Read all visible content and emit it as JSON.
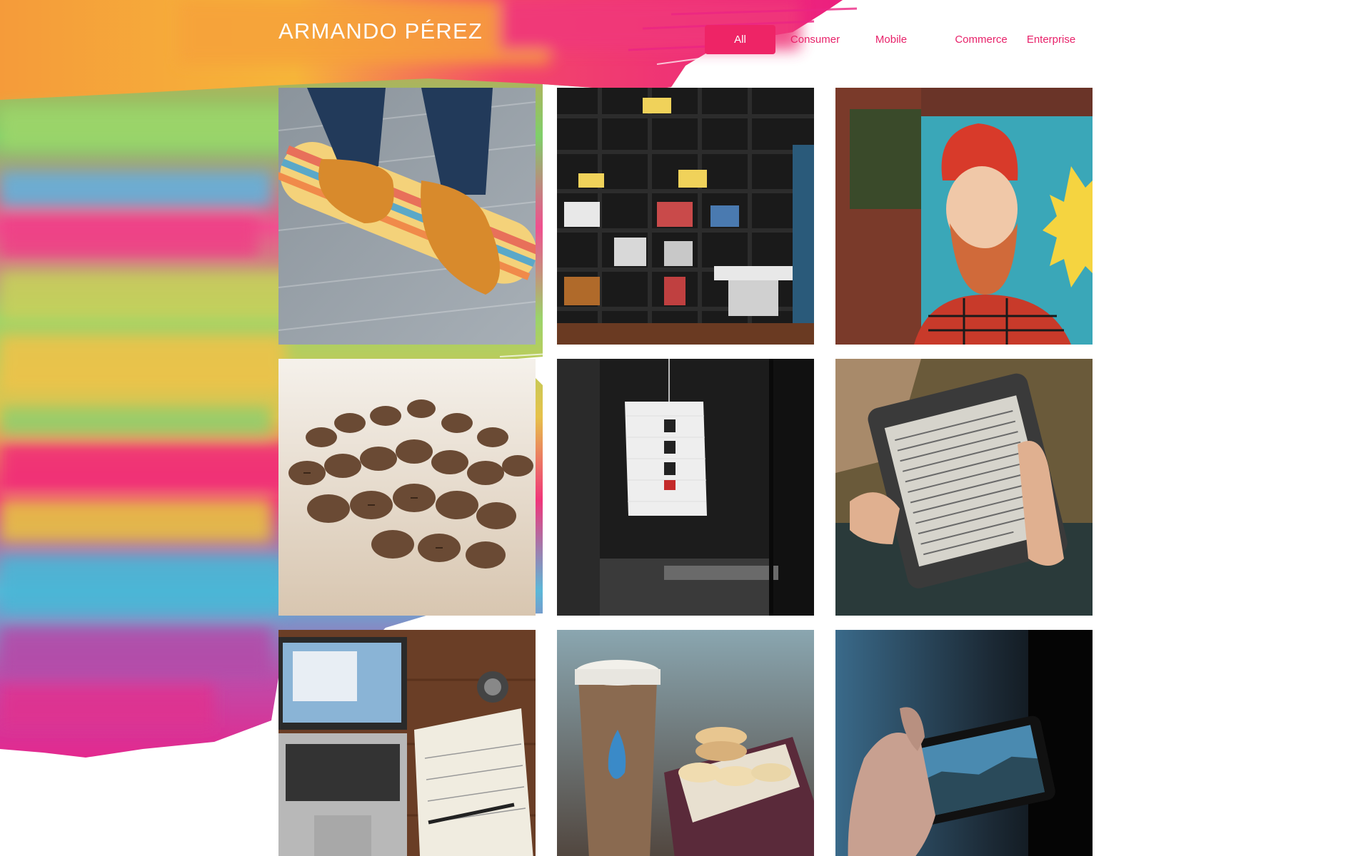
{
  "header": {
    "title": "ARMANDO PÉREZ"
  },
  "filters": {
    "active": "All",
    "items": [
      {
        "label": "All"
      },
      {
        "label": "Consumer"
      },
      {
        "label": "Mobile"
      },
      {
        "label": "Commerce"
      },
      {
        "label": "Enterprise"
      }
    ]
  },
  "theme": {
    "accent": "#ee2466",
    "title_color": "#ffffff",
    "background": "#ffffff"
  },
  "portfolio": {
    "tiles": [
      {
        "subject": "skateboard-shoes-photo"
      },
      {
        "subject": "bookshelf-photo"
      },
      {
        "subject": "mural-portrait-photo"
      },
      {
        "subject": "coffee-beans-photo"
      },
      {
        "subject": "paper-lantern-photo"
      },
      {
        "subject": "ereader-photo"
      },
      {
        "subject": "laptop-notebook-photo"
      },
      {
        "subject": "coffee-macarons-photo"
      },
      {
        "subject": "phone-camera-photo"
      }
    ]
  }
}
